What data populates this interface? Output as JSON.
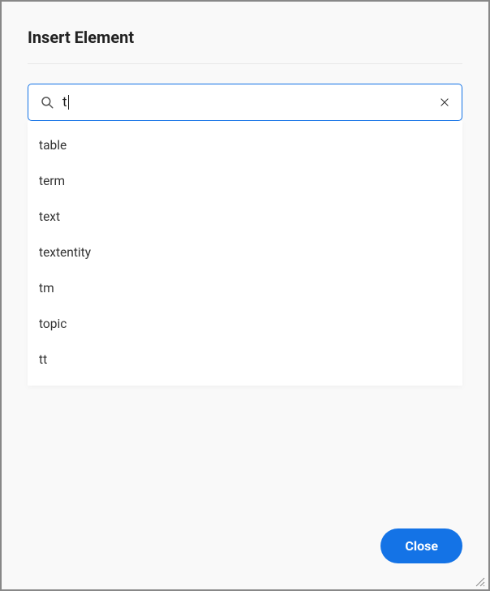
{
  "dialog": {
    "title": "Insert Element",
    "close_label": "Close"
  },
  "search": {
    "value": "t"
  },
  "results": {
    "items": [
      {
        "label": "table"
      },
      {
        "label": "term"
      },
      {
        "label": "text"
      },
      {
        "label": "textentity"
      },
      {
        "label": "tm"
      },
      {
        "label": "topic"
      },
      {
        "label": "tt"
      }
    ]
  }
}
